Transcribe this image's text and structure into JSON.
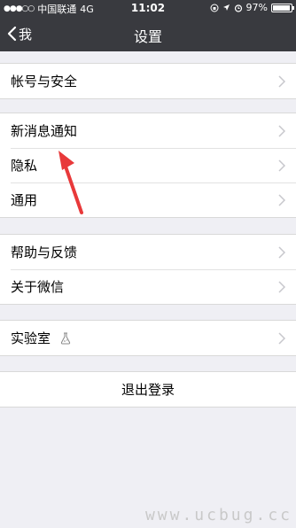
{
  "statusbar": {
    "carrier": "中国联通",
    "network": "4G",
    "time": "11:02",
    "battery": "97%",
    "battery_level": 0.97
  },
  "navbar": {
    "back_label": "我",
    "title": "设置"
  },
  "groups": [
    {
      "items": [
        {
          "label": "帐号与安全"
        }
      ]
    },
    {
      "items": [
        {
          "label": "新消息通知"
        },
        {
          "label": "隐私"
        },
        {
          "label": "通用"
        }
      ]
    },
    {
      "items": [
        {
          "label": "帮助与反馈"
        },
        {
          "label": "关于微信"
        }
      ]
    },
    {
      "items": [
        {
          "label": "实验室",
          "icon": "flask-icon"
        }
      ]
    }
  ],
  "logout": {
    "label": "退出登录"
  },
  "watermark": "www.ucbug.cc",
  "colors": {
    "bar": "#393a3f",
    "background": "#efeff4",
    "arrow": "#e8393a"
  }
}
